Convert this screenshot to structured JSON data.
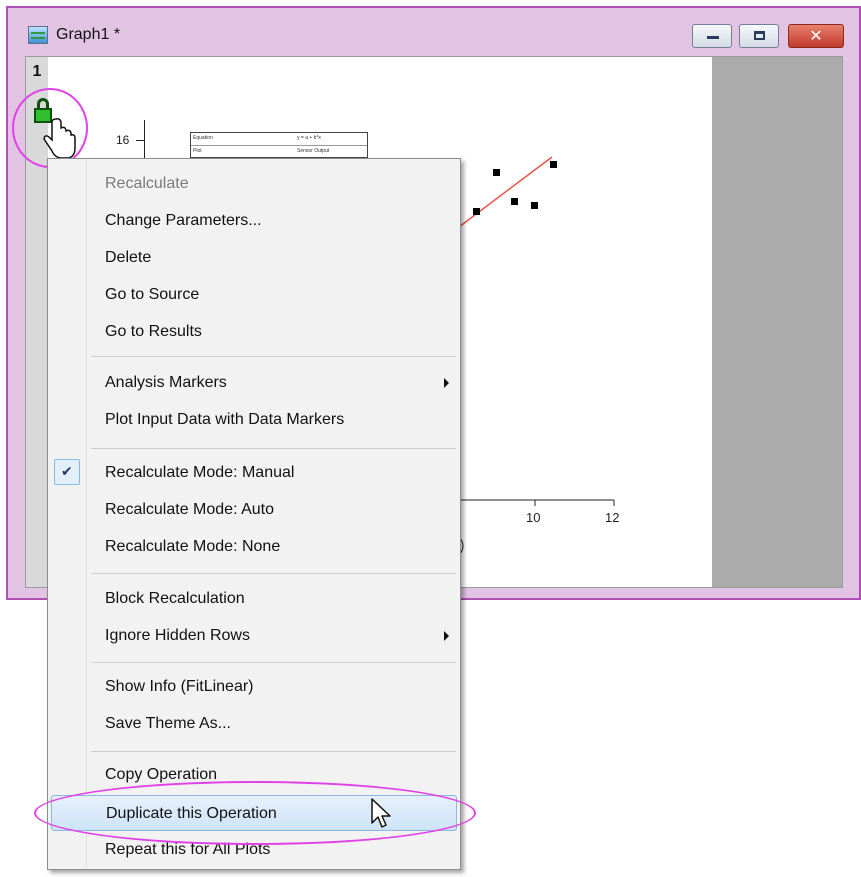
{
  "window": {
    "title": "Graph1 *",
    "layer_number": "1"
  },
  "plot": {
    "y_tick_label": "16",
    "legend_table": [
      {
        "col1": "Equation",
        "col2": "y = a + b*x"
      },
      {
        "col1": "Plot",
        "col2": "Sensor Output"
      }
    ],
    "x_tick_labels": [
      "10",
      "12"
    ]
  },
  "context_menu": {
    "items": [
      {
        "label": "Recalculate",
        "disabled": true
      },
      {
        "label": "Change Parameters..."
      },
      {
        "label": "Delete"
      },
      {
        "label": "Go to Source"
      },
      {
        "label": "Go to Results"
      },
      {
        "label": "Analysis Markers",
        "submenu": true
      },
      {
        "label": "Plot Input Data with Data Markers"
      },
      {
        "label": "Recalculate Mode: Manual",
        "checked": true
      },
      {
        "label": "Recalculate Mode: Auto"
      },
      {
        "label": "Recalculate Mode: None"
      },
      {
        "label": "Block Recalculation"
      },
      {
        "label": "Ignore Hidden Rows",
        "submenu": true
      },
      {
        "label": "Show Info (FitLinear)"
      },
      {
        "label": "Save Theme As..."
      },
      {
        "label": "Copy Operation"
      },
      {
        "label": "Duplicate this Operation",
        "hovered": true
      },
      {
        "label": "Repeat this for All Plots"
      }
    ]
  },
  "colors": {
    "window_border": "#b04fb4",
    "window_frame": "#e2c3e4",
    "highlight": "#e040e8",
    "fit_line": "#e8554a",
    "lock_green": "#2fbf2f"
  }
}
